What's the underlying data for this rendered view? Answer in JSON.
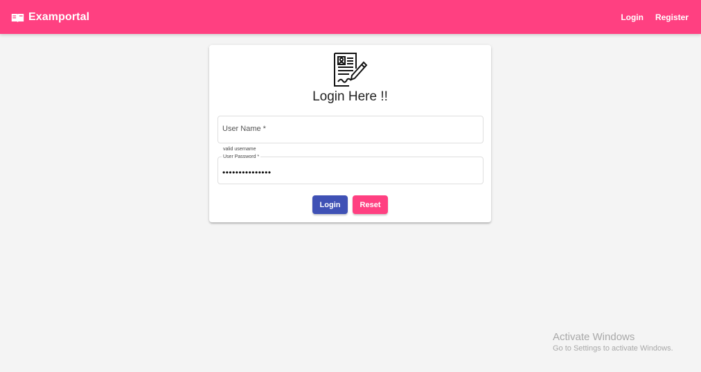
{
  "toolbar": {
    "brand_icon": "book-icon",
    "brand_title": "Examportal",
    "color": "#ff4081",
    "links": {
      "login": "Login",
      "register": "Register"
    }
  },
  "login_card": {
    "logo_icon": "document-edit-icon",
    "title": "Login Here !!",
    "username": {
      "placeholder": "User Name *",
      "value": "",
      "hint": "valid username"
    },
    "password": {
      "label": "User Password *",
      "value": "•••••••••••••••"
    },
    "buttons": {
      "login": "Login",
      "reset": "Reset"
    },
    "colors": {
      "primary": "#3f51b5",
      "accent": "#ff4081"
    }
  },
  "watermark": {
    "title": "Activate Windows",
    "subtitle": "Go to Settings to activate Windows."
  }
}
